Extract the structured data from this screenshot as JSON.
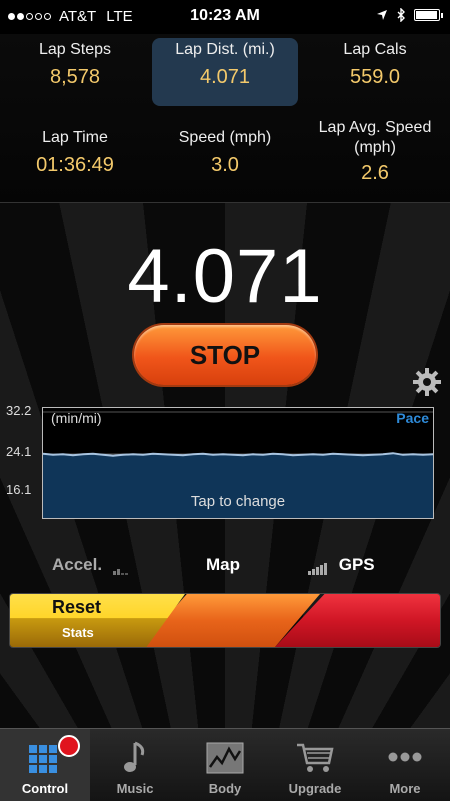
{
  "status_bar": {
    "carrier": "AT&T",
    "network": "LTE",
    "time": "10:23 AM",
    "battery_level": 0.95
  },
  "stats": [
    {
      "label": "Lap Steps",
      "value": "8,578"
    },
    {
      "label": "Lap Dist. (mi.)",
      "value": "4.071",
      "highlighted": true
    },
    {
      "label": "Lap Cals",
      "value": "559.0"
    },
    {
      "label": "Lap Time",
      "value": "01:36:49"
    },
    {
      "label": "Speed (mph)",
      "value": "3.0"
    },
    {
      "label": "Lap Avg. Speed (mph)",
      "value": "2.6"
    }
  ],
  "main": {
    "big_value": "4.071",
    "stop_label": "STOP"
  },
  "chart_data": {
    "type": "line",
    "unit_label": "(min/mi)",
    "mode_label": "Pace",
    "footer": "Tap to change",
    "yticks": [
      "32.2",
      "24.1",
      "16.1"
    ],
    "ylim": [
      16.1,
      32.2
    ],
    "values": [
      24.2,
      24.0,
      24.1,
      23.9,
      24.1,
      24.2,
      24.0,
      23.8,
      24.0,
      24.1,
      24.0,
      24.2,
      24.1,
      24.0,
      23.9,
      24.1,
      24.2,
      24.0,
      24.1,
      24.0,
      23.9,
      24.1,
      24.0,
      24.2,
      24.1,
      23.9,
      24.0,
      24.1,
      24.0,
      24.2,
      24.1,
      24.0,
      23.9,
      24.0,
      24.1,
      24.3,
      24.0,
      24.1,
      24.0,
      24.1
    ],
    "line_color": "#a8c4e0",
    "fill_color": "#0f3558"
  },
  "modes": {
    "accel": "Accel.",
    "map": "Map",
    "gps": "GPS"
  },
  "control_bar": {
    "reset_label": "Reset",
    "stats_label": "Stats"
  },
  "tabs": [
    {
      "label": "Control",
      "icon": "grid-icon"
    },
    {
      "label": "Music",
      "icon": "music-note-icon"
    },
    {
      "label": "Body",
      "icon": "chart-icon"
    },
    {
      "label": "Upgrade",
      "icon": "cart-icon"
    },
    {
      "label": "More",
      "icon": "more-dots-icon"
    }
  ]
}
